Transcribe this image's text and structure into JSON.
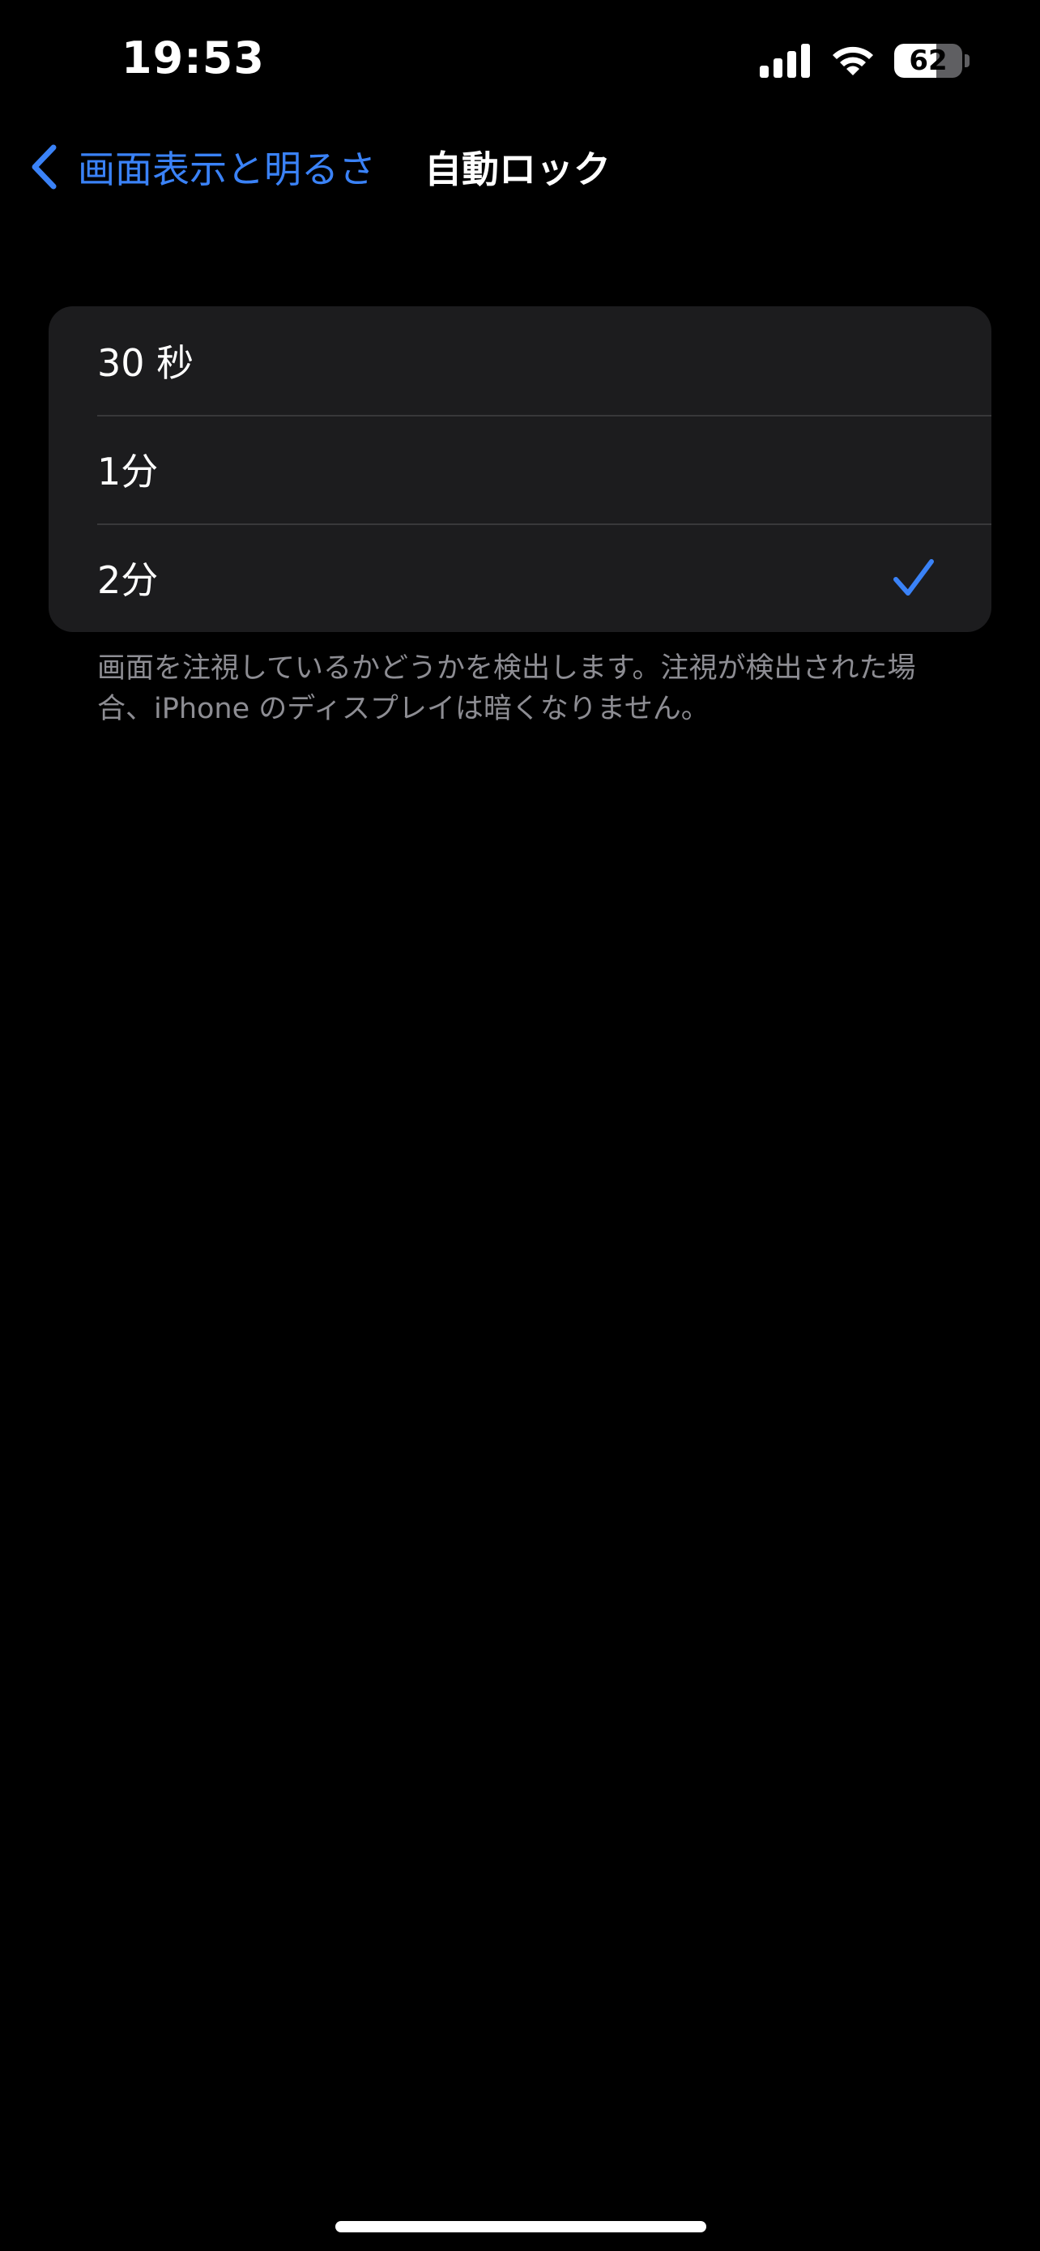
{
  "status_bar": {
    "time": "19:53",
    "signal_bars": 4,
    "wifi": "wifi-icon",
    "battery_level": "62",
    "battery_fraction": 0.62
  },
  "nav": {
    "back_label": "画面表示と明るさ",
    "title": "自動ロック"
  },
  "options": [
    {
      "label": "30 秒",
      "selected": false
    },
    {
      "label": "1分",
      "selected": false
    },
    {
      "label": "2分",
      "selected": true
    }
  ],
  "footer_note": "画面を注視しているかどうかを検出します。注視が検出された場合、iPhone のディスプレイは暗くなりません。",
  "colors": {
    "background": "#000000",
    "group_background": "#1c1c1e",
    "accent": "#3a82f7",
    "separator": "#38383a",
    "secondary_text": "#8d8d93"
  }
}
